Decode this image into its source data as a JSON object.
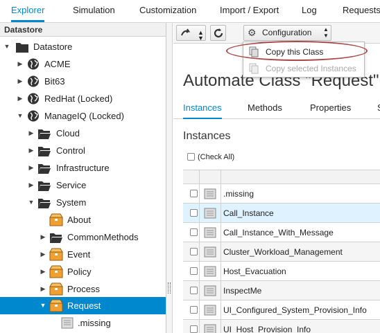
{
  "topnav": {
    "tabs": [
      {
        "label": "Explorer",
        "active": true
      },
      {
        "label": "Simulation"
      },
      {
        "label": "Customization"
      },
      {
        "label": "Import / Export"
      },
      {
        "label": "Log"
      },
      {
        "label": "Requests"
      }
    ]
  },
  "sidebar": {
    "header": "Datastore",
    "tree": [
      {
        "label": "Datastore",
        "icon": "folder-icon",
        "expanded": true
      },
      {
        "label": "ACME",
        "icon": "globe-icon",
        "expanded": false
      },
      {
        "label": "Bit63",
        "icon": "globe-icon",
        "expanded": false
      },
      {
        "label": "RedHat (Locked)",
        "icon": "globe-icon",
        "expanded": false
      },
      {
        "label": "ManageIQ (Locked)",
        "icon": "globe-icon",
        "expanded": true
      },
      {
        "label": "Cloud",
        "icon": "folder-icon",
        "expanded": false
      },
      {
        "label": "Control",
        "icon": "folder-icon",
        "expanded": false
      },
      {
        "label": "Infrastructure",
        "icon": "folder-icon",
        "expanded": false
      },
      {
        "label": "Service",
        "icon": "folder-icon",
        "expanded": false
      },
      {
        "label": "System",
        "icon": "folder-icon",
        "expanded": true
      },
      {
        "label": "About",
        "icon": "class-icon"
      },
      {
        "label": "CommonMethods",
        "icon": "folder-icon",
        "expanded": false
      },
      {
        "label": "Event",
        "icon": "class-icon",
        "expanded": false
      },
      {
        "label": "Policy",
        "icon": "class-icon",
        "expanded": false
      },
      {
        "label": "Process",
        "icon": "class-icon",
        "expanded": false
      },
      {
        "label": "Request",
        "icon": "class-icon",
        "expanded": true,
        "selected": true
      },
      {
        "label": ".missing",
        "icon": "instance-icon"
      }
    ]
  },
  "toolbar": {
    "configuration_label": "Configuration",
    "menu": {
      "items": [
        {
          "label": "Copy this Class",
          "enabled": true
        },
        {
          "label": "Copy selected Instances",
          "enabled": false
        }
      ]
    }
  },
  "main": {
    "title": "Automate Class \"Request\"",
    "tabs": [
      {
        "label": "Instances",
        "active": true
      },
      {
        "label": "Methods"
      },
      {
        "label": "Properties"
      },
      {
        "label": "S"
      }
    ],
    "section_title": "Instances",
    "check_all_label": "(Check All)",
    "rows": [
      {
        "name": ".missing"
      },
      {
        "name": "Call_Instance",
        "selected": true
      },
      {
        "name": "Call_Instance_With_Message"
      },
      {
        "name": "Cluster_Workload_Management"
      },
      {
        "name": "Host_Evacuation"
      },
      {
        "name": "InspectMe"
      },
      {
        "name": "UI_Configured_System_Provision_Info"
      },
      {
        "name": "UI_Host_Provision_Info"
      }
    ]
  },
  "colors": {
    "accent": "#0088ce",
    "selected_row": "#def3ff",
    "highlight_ring": "#a84a4a"
  }
}
